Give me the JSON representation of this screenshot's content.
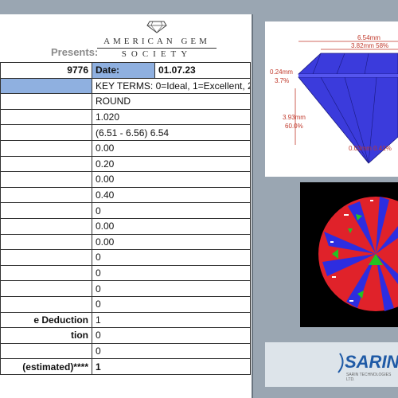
{
  "header": {
    "presents": "Presents:",
    "logo_line1": "AMERICAN GEM",
    "logo_line2": "SOCIETY"
  },
  "report": {
    "number_partial": "9776",
    "date_label": "Date:",
    "date_value": "01.07.23",
    "key_terms": "KEY TERMS: 0=Ideal, 1=Excellent, 2=Very Good",
    "rows": [
      {
        "label": "",
        "value": "ROUND"
      },
      {
        "label": "",
        "value": "1.020"
      },
      {
        "label": "",
        "value": "(6.51 - 6.56) 6.54"
      },
      {
        "label": "",
        "value": "0.00"
      },
      {
        "label": "",
        "value": "0.20"
      },
      {
        "label": "",
        "value": "0.00"
      },
      {
        "label": "",
        "value": "0.40"
      },
      {
        "label": "",
        "value": "0"
      },
      {
        "label": "",
        "value": "0.00"
      },
      {
        "label": "",
        "value": "0.00"
      },
      {
        "label": "",
        "value": "0"
      },
      {
        "label": "",
        "value": "0"
      },
      {
        "label": "",
        "value": "0"
      },
      {
        "label": "",
        "value": "0"
      },
      {
        "label": "e Deduction",
        "value": "1"
      },
      {
        "label": "tion",
        "value": "0"
      },
      {
        "label": "",
        "value": "0"
      },
      {
        "label": "(estimated)****",
        "value": "1"
      }
    ]
  },
  "diagram": {
    "width_mm": "6.54mm",
    "table_mm": "3.82mm 58%",
    "crown_mm": "0.24mm",
    "crown_pct": "3.7%",
    "depth_mm": "3.93mm",
    "depth_pct": "60.0%",
    "culet": "0.03mm 0.41%"
  },
  "sarin": {
    "brand": "SARIN",
    "sub": "SARIN TECHNOLOGIES LTD."
  },
  "colors": {
    "pavilion": "#3b3bdc",
    "hearts_red": "#e0222a",
    "hearts_blue": "#2d2de0",
    "hearts_green": "#22c322",
    "label_blue": "#8fb0e0"
  }
}
